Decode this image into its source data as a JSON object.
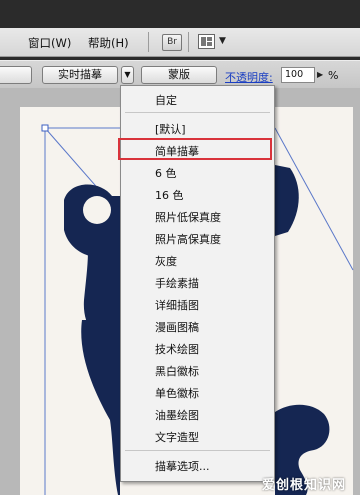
{
  "menubar": {
    "window_label": "窗口(W)",
    "help_label": "帮助(H)",
    "bridge_label": "Br",
    "arrange_dropdown": "▼"
  },
  "control_bar": {
    "preset_button": "",
    "live_trace_button": "实时描摹",
    "trace_dropdown_arrow": "▼",
    "mask_button": "蒙版",
    "opacity_label": "不透明度:",
    "opacity_value": "100",
    "opacity_arrow": "▶",
    "opacity_unit": "%"
  },
  "trace_menu": {
    "items": [
      {
        "label": "自定",
        "highlighted": false
      },
      {
        "label": "[默认]",
        "highlighted": false
      },
      {
        "label": "简单描摹",
        "highlighted": true
      },
      {
        "label": "6 色",
        "highlighted": false
      },
      {
        "label": "16 色",
        "highlighted": false
      },
      {
        "label": "照片低保真度",
        "highlighted": false
      },
      {
        "label": "照片高保真度",
        "highlighted": false
      },
      {
        "label": "灰度",
        "highlighted": false
      },
      {
        "label": "手绘素描",
        "highlighted": false
      },
      {
        "label": "详细插图",
        "highlighted": false
      },
      {
        "label": "漫画图稿",
        "highlighted": false
      },
      {
        "label": "技术绘图",
        "highlighted": false
      },
      {
        "label": "黑白徽标",
        "highlighted": false
      },
      {
        "label": "单色徽标",
        "highlighted": false
      },
      {
        "label": "油墨绘图",
        "highlighted": false
      },
      {
        "label": "文字造型",
        "highlighted": false
      },
      {
        "label": "描摹选项...",
        "highlighted": false
      }
    ]
  },
  "watermark": "爱创根知识网",
  "colors": {
    "highlight_border": "#d9333b",
    "artwork_navy": "#152652",
    "link_blue": "#1a3ec2"
  }
}
